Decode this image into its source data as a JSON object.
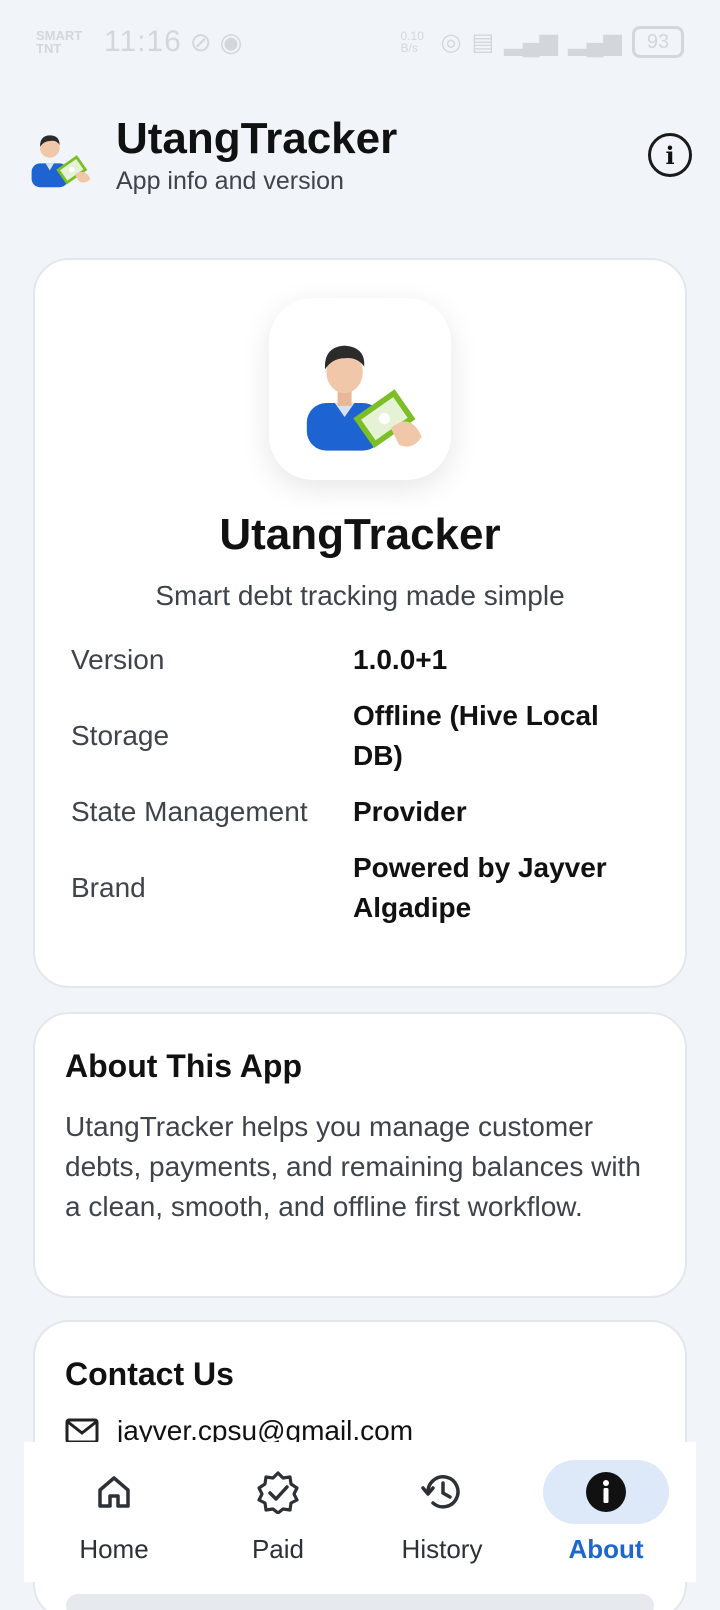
{
  "status_bar": {
    "carrier": "SMART TNT",
    "time": "11:16",
    "net_speed": "0.10 B/s",
    "battery": "93"
  },
  "header": {
    "title": "UtangTracker",
    "subtitle": "App info and version"
  },
  "app_card": {
    "name": "UtangTracker",
    "tagline": "Smart debt tracking made simple",
    "rows": [
      {
        "key": "Version",
        "value": "1.0.0+1"
      },
      {
        "key": "Storage",
        "value": "Offline (Hive Local DB)"
      },
      {
        "key": "State Management",
        "value": "Provider"
      },
      {
        "key": "Brand",
        "value": "Powered by Jayver Algadipe"
      }
    ]
  },
  "about": {
    "title": "About This App",
    "body": "UtangTracker helps you manage customer debts, payments, and remaining balances with a clean, smooth, and offline first workflow."
  },
  "contact": {
    "title": "Contact Us",
    "email": "jayver.cpsu@gmail.com"
  },
  "nav": {
    "items": [
      {
        "label": "Home",
        "icon": "home-icon",
        "active": false
      },
      {
        "label": "Paid",
        "icon": "verified-badge-icon",
        "active": false
      },
      {
        "label": "History",
        "icon": "history-icon",
        "active": false
      },
      {
        "label": "About",
        "icon": "info-icon",
        "active": true
      }
    ]
  },
  "colors": {
    "background": "#f1f5f9",
    "accent": "#1d68cf",
    "active_pill": "#dde9f8",
    "card": "#ffffff"
  }
}
